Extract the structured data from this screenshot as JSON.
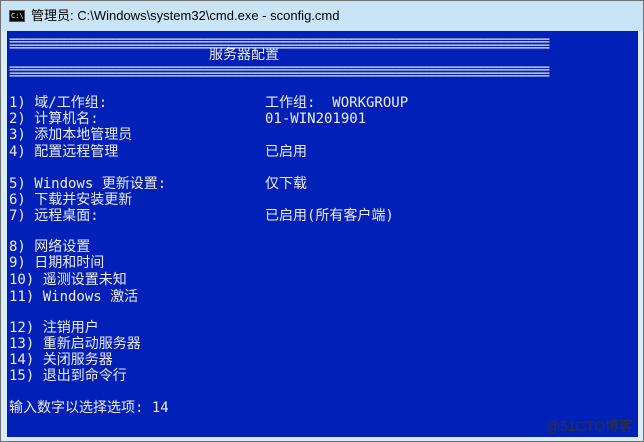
{
  "window": {
    "title": "管理员: C:\\Windows\\system32\\cmd.exe - sconfig.cmd",
    "icon_label": "C:\\",
    "icon": "cmd-icon"
  },
  "console": {
    "background": "#0020b8",
    "separator": "===============================================================================",
    "header": "服务器配置",
    "menu": [
      {
        "label": "1) 域/工作组:",
        "value": "工作组:  WORKGROUP"
      },
      {
        "label": "2) 计算机名:",
        "value": "01-WIN201901"
      },
      {
        "label": "3) 添加本地管理员",
        "value": ""
      },
      {
        "label": "4) 配置远程管理",
        "value": "已启用"
      },
      {
        "label": "5) Windows 更新设置:",
        "value": "仅下载"
      },
      {
        "label": "6) 下载并安装更新",
        "value": ""
      },
      {
        "label": "7) 远程桌面:",
        "value": "已启用(所有客户端)"
      },
      {
        "label": "8) 网络设置",
        "value": ""
      },
      {
        "label": "9) 日期和时间",
        "value": ""
      },
      {
        "label": "10) 遥测设置未知",
        "value": ""
      },
      {
        "label": "11) Windows 激活",
        "value": ""
      },
      {
        "label": "12) 注销用户",
        "value": ""
      },
      {
        "label": "13) 重新启动服务器",
        "value": ""
      },
      {
        "label": "14) 关闭服务器",
        "value": ""
      },
      {
        "label": "15) 退出到命令行",
        "value": ""
      }
    ],
    "prompt": "输入数字以选择选项: 14"
  },
  "watermark": "@51CTO博客"
}
